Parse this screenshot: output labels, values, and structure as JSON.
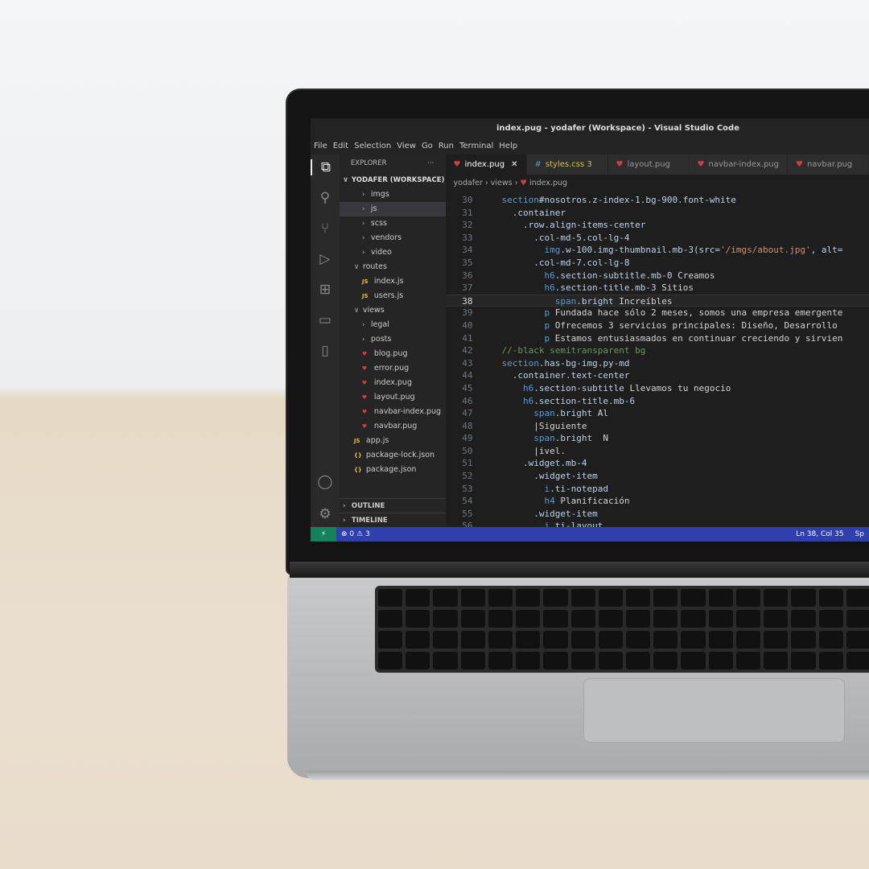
{
  "window": {
    "title": "index.pug - yodafer (Workspace) - Visual Studio Code"
  },
  "menu": [
    "File",
    "Edit",
    "Selection",
    "View",
    "Go",
    "Run",
    "Terminal",
    "Help"
  ],
  "activity_icons": [
    "files-icon",
    "search-icon",
    "source-control-icon",
    "run-debug-icon",
    "extensions-icon",
    "remote-explorer-icon",
    "book-icon"
  ],
  "activity_bottom": [
    "account-icon",
    "settings-gear-icon"
  ],
  "sidebar": {
    "title": "EXPLORER",
    "more": "···",
    "workspace": "YODAFER (WORKSPACE)",
    "items": [
      {
        "label": "imgs",
        "type": "folder",
        "open": false,
        "depth": 2
      },
      {
        "label": "js",
        "type": "folder",
        "open": false,
        "depth": 2,
        "selected": true
      },
      {
        "label": "scss",
        "type": "folder",
        "open": false,
        "depth": 2
      },
      {
        "label": "vendors",
        "type": "folder",
        "open": false,
        "depth": 2
      },
      {
        "label": "video",
        "type": "folder",
        "open": false,
        "depth": 2
      },
      {
        "label": "routes",
        "type": "folder",
        "open": true,
        "depth": 1
      },
      {
        "label": "index.js",
        "type": "js",
        "depth": 2
      },
      {
        "label": "users.js",
        "type": "js",
        "depth": 2
      },
      {
        "label": "views",
        "type": "folder",
        "open": true,
        "depth": 1
      },
      {
        "label": "legal",
        "type": "folder",
        "open": false,
        "depth": 2
      },
      {
        "label": "posts",
        "type": "folder",
        "open": false,
        "depth": 2
      },
      {
        "label": "blog.pug",
        "type": "pug",
        "depth": 2
      },
      {
        "label": "error.pug",
        "type": "pug",
        "depth": 2
      },
      {
        "label": "index.pug",
        "type": "pug",
        "depth": 2
      },
      {
        "label": "layout.pug",
        "type": "pug",
        "depth": 2
      },
      {
        "label": "navbar-index.pug",
        "type": "pug",
        "depth": 2
      },
      {
        "label": "navbar.pug",
        "type": "pug",
        "depth": 2
      },
      {
        "label": "app.js",
        "type": "js",
        "depth": 1
      },
      {
        "label": "package-lock.json",
        "type": "json",
        "depth": 1
      },
      {
        "label": "package.json",
        "type": "json",
        "depth": 1
      }
    ],
    "outline": "OUTLINE",
    "timeline": "TIMELINE"
  },
  "tabs": [
    {
      "label": "index.pug",
      "icon": "pug",
      "active": true,
      "close": "✕"
    },
    {
      "label": "styles.css 3",
      "icon": "css",
      "modified": true
    },
    {
      "label": "layout.pug",
      "icon": "pug"
    },
    {
      "label": "navbar-index.pug",
      "icon": "pug"
    },
    {
      "label": "navbar.pug",
      "icon": "pug"
    }
  ],
  "breadcrumb": [
    "yodafer",
    "views",
    "index.pug"
  ],
  "code": [
    {
      "n": 30,
      "i": 0,
      "t": [
        [
          "kw",
          "section"
        ],
        [
          "cls",
          "#nosotros.z-index-1.bg-900.font-white"
        ]
      ]
    },
    {
      "n": 31,
      "i": 1,
      "t": [
        [
          "cls",
          ".container"
        ]
      ]
    },
    {
      "n": 32,
      "i": 2,
      "t": [
        [
          "cls",
          ".row.align-items-center"
        ]
      ]
    },
    {
      "n": 33,
      "i": 3,
      "t": [
        [
          "cls",
          ".col-md-5.col-lg-4"
        ]
      ]
    },
    {
      "n": 34,
      "i": 4,
      "t": [
        [
          "kw",
          "img"
        ],
        [
          "cls",
          ".w-100.img-thumbnail.mb-3(src="
        ],
        [
          "str",
          "'/imgs/about.jpg'"
        ],
        [
          "cls",
          ", alt="
        ]
      ]
    },
    {
      "n": 35,
      "i": 3,
      "t": [
        [
          "cls",
          ".col-md-7.col-lg-8"
        ]
      ]
    },
    {
      "n": 36,
      "i": 4,
      "t": [
        [
          "kw",
          "h6"
        ],
        [
          "cls",
          ".section-subtitle.mb-0 "
        ],
        [
          "txt",
          "Creamos"
        ]
      ]
    },
    {
      "n": 37,
      "i": 4,
      "t": [
        [
          "kw",
          "h6"
        ],
        [
          "cls",
          ".section-title.mb-3 "
        ],
        [
          "txt",
          "Sitios"
        ]
      ]
    },
    {
      "n": 38,
      "i": 5,
      "t": [
        [
          "kw",
          "span"
        ],
        [
          "cls",
          ".bright "
        ],
        [
          "txt",
          "Increíbles"
        ]
      ],
      "current": true
    },
    {
      "n": 39,
      "i": 4,
      "t": [
        [
          "kw",
          "p"
        ],
        [
          "txt",
          " Fundada hace sólo 2 meses, somos una empresa emergente"
        ]
      ]
    },
    {
      "n": 40,
      "i": 4,
      "t": [
        [
          "kw",
          "p"
        ],
        [
          "txt",
          " Ofrecemos 3 servicios principales: Diseño, Desarrollo"
        ]
      ]
    },
    {
      "n": 41,
      "i": 4,
      "t": [
        [
          "kw",
          "p"
        ],
        [
          "txt",
          " Estamos entusiasmados en continuar creciendo y sirvien"
        ]
      ]
    },
    {
      "n": 42,
      "i": 0,
      "t": [
        [
          "cm",
          "//-black semitransparent bg"
        ]
      ]
    },
    {
      "n": 43,
      "i": 0,
      "t": [
        [
          "kw",
          "section"
        ],
        [
          "cls",
          ".has-bg-img.py-md"
        ]
      ]
    },
    {
      "n": 44,
      "i": 1,
      "t": [
        [
          "cls",
          ".container.text-center"
        ]
      ]
    },
    {
      "n": 45,
      "i": 2,
      "t": [
        [
          "kw",
          "h6"
        ],
        [
          "cls",
          ".section-subtitle "
        ],
        [
          "txt",
          "Llevamos tu negocio"
        ]
      ]
    },
    {
      "n": 46,
      "i": 2,
      "t": [
        [
          "kw",
          "h6"
        ],
        [
          "cls",
          ".section-title.mb-6"
        ]
      ]
    },
    {
      "n": 47,
      "i": 3,
      "t": [
        [
          "kw",
          "span"
        ],
        [
          "cls",
          ".bright "
        ],
        [
          "txt",
          "Al"
        ]
      ]
    },
    {
      "n": 48,
      "i": 3,
      "t": [
        [
          "txt",
          "|Siguiente"
        ]
      ]
    },
    {
      "n": 49,
      "i": 3,
      "t": [
        [
          "kw",
          "span"
        ],
        [
          "cls",
          ".bright "
        ],
        [
          "txt",
          " N"
        ]
      ]
    },
    {
      "n": 50,
      "i": 3,
      "t": [
        [
          "txt",
          "|ivel."
        ]
      ]
    },
    {
      "n": 51,
      "i": 2,
      "t": [
        [
          "cls",
          ".widget.mb-4"
        ]
      ]
    },
    {
      "n": 52,
      "i": 3,
      "t": [
        [
          "cls",
          ".widget-item"
        ]
      ]
    },
    {
      "n": 53,
      "i": 4,
      "t": [
        [
          "kw",
          "i"
        ],
        [
          "cls",
          ".ti-notepad"
        ]
      ]
    },
    {
      "n": 54,
      "i": 4,
      "t": [
        [
          "kw",
          "h4"
        ],
        [
          "txt",
          " Planificación"
        ]
      ]
    },
    {
      "n": 55,
      "i": 3,
      "t": [
        [
          "cls",
          ".widget-item"
        ]
      ]
    },
    {
      "n": 56,
      "i": 4,
      "t": [
        [
          "kw",
          "i"
        ],
        [
          "cls",
          ".ti-layout"
        ]
      ]
    }
  ],
  "status": {
    "remote": "⚡",
    "errors": "⊗ 0",
    "warnings": "⚠ 3",
    "position": "Ln 38, Col 35",
    "spaces": "Sp"
  },
  "colors": {
    "status_bar": "#2f3fae",
    "remote": "#16825d",
    "keyword": "#569cd6",
    "comment": "#6a9955",
    "string": "#ce9178",
    "pug": "#d43d3d"
  }
}
